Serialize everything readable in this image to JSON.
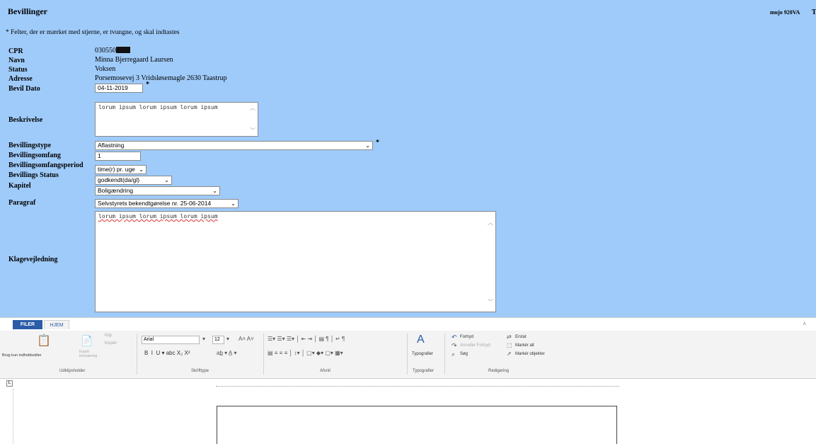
{
  "app_title": "Bevillinger",
  "user_label": "mujo 920VA",
  "edge_char": "T",
  "note": "* Felter, der er mærket med stjerne, er tvungne, og skal indtastes",
  "fields": {
    "cpr": {
      "label": "CPR",
      "value": "030550"
    },
    "navn": {
      "label": "Navn",
      "value": "Minna Bjerregaard Laursen"
    },
    "status": {
      "label": "Status",
      "value": "Voksen"
    },
    "adresse": {
      "label": "Adresse",
      "value": "Porsemosevej 3 Vridsløsemagle 2630 Taastrup"
    },
    "bevil_dato": {
      "label": "Bevil Dato",
      "value": "04-11-2019"
    },
    "beskrivelse": {
      "label": "Beskrivelse",
      "value": "lorum ipsum lorum ipsum lorum ipsum"
    },
    "bevillingstype": {
      "label": "Bevillingstype",
      "value": "Aflastning"
    },
    "bevillingsomfang": {
      "label": "Bevillingsomfang",
      "value": "1"
    },
    "bevillingsomfangsperiod": {
      "label": "Bevillingsomfangsperiod",
      "value": "time(r) pr. uge"
    },
    "bevillings_status": {
      "label": "Bevillings Status",
      "value": "godkendt(da/gl)"
    },
    "kapitel": {
      "label": "Kapitel",
      "value": "Boligændring"
    },
    "paragraf": {
      "label": "Paragraf",
      "value": "Selvstyrets bekendtgørelse nr.",
      "value_date": "25-06-2014"
    },
    "klagevejledning": {
      "label": "Klagevejledning",
      "value": "lorum ipsum lorum ipsum lorum ipsum"
    }
  },
  "required_mark": "*",
  "ribbon": {
    "tabs": [
      "FILER",
      "HJEM"
    ],
    "clipboard": {
      "paste": "Brug kun indholdsstiler",
      "cut": "Klip",
      "copy": "Kopiér",
      "format_painter": "Kopiér formatering",
      "label": "Udklipsholder"
    },
    "font": {
      "family": "Arial",
      "size": "12",
      "label": "Skrifttype"
    },
    "paragraph": {
      "label": "Afsnit"
    },
    "styles": {
      "button": "Typografier",
      "label": "Typografier"
    },
    "editing": {
      "undo": "Fortryd",
      "redo": "Annuller Fortryd",
      "find": "Søg",
      "replace": "Erstat",
      "select_all": "Markér alt",
      "select_objects": "Markér objekter",
      "label": "Redigering"
    }
  },
  "colors": {
    "form_bg": "#9fcbfa",
    "file_tab": "#2a5ca8"
  }
}
